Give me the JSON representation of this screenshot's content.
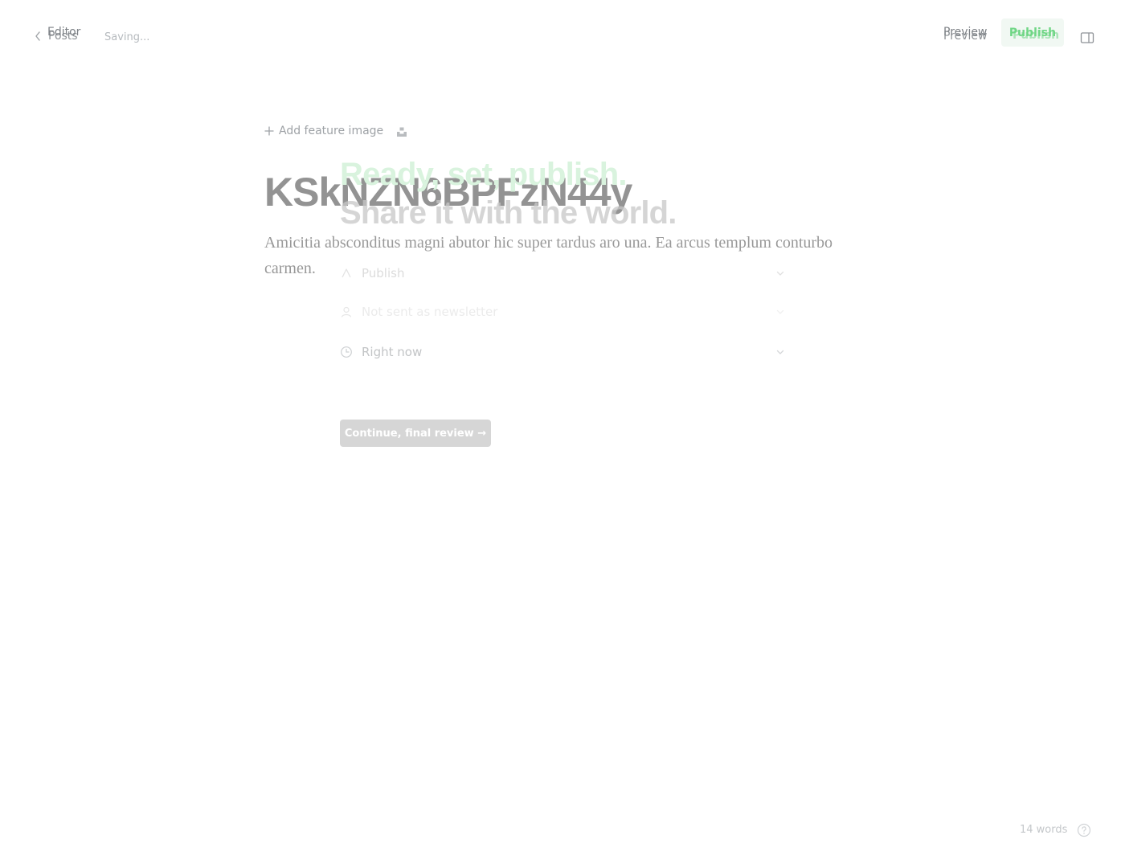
{
  "editor": {
    "back_label": "Posts",
    "status": "Saving...",
    "preview_label": "Preview",
    "publish_label": "Publish",
    "feature_image_label": "Add feature image",
    "post_title": "KSkNZN6BPFzN44y",
    "excerpt": "Amicitia absconditus magni abutor hic super tardus aro una. Ea arcus templum conturbo carmen.",
    "word_count": "14 words"
  },
  "publish_flow": {
    "editor_label": "Editor",
    "preview_label": "Preview",
    "publish_label": "Publish",
    "heading_line1": "Ready, set, publish.",
    "heading_line2": "Share it with the world.",
    "options": [
      {
        "icon": "publish-icon",
        "label": "Publish"
      },
      {
        "icon": "newsletter-user-icon",
        "label": "Not sent as newsletter"
      },
      {
        "icon": "clock-icon",
        "label": "Right now"
      }
    ],
    "continue_label": "Continue, final review →"
  },
  "colors": {
    "accent_green": "#7fdc93",
    "text_grey": "#8a8a8a"
  }
}
